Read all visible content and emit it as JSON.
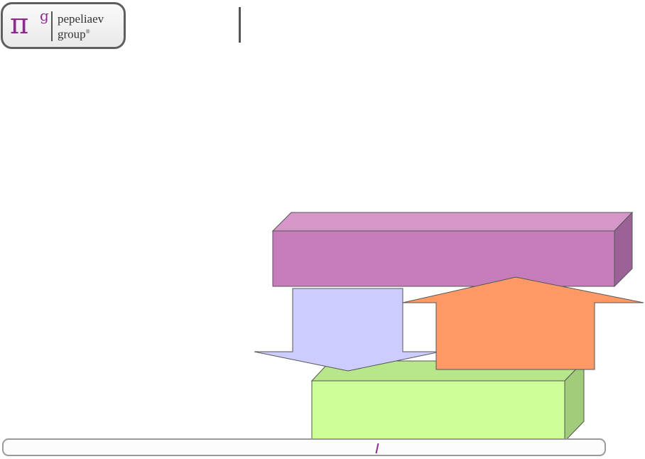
{
  "logo": {
    "symbol": "π",
    "superscript": "g",
    "line1": "pepeliaev",
    "line2": "group",
    "registered": "®"
  },
  "colors": {
    "brand_purple": "#8a2c8c",
    "top_box_front": "#c77dbb",
    "top_box_top": "#d596c8",
    "top_box_side": "#9c6298",
    "down_arrow": "#ccccff",
    "up_arrow": "#ff9966",
    "bottom_box_front": "#ccff99",
    "bottom_box_top": "#b8e68a",
    "bottom_box_side": "#a3cc7a"
  },
  "diagram": {
    "top_block": "",
    "down_arrow": "",
    "up_arrow": "",
    "bottom_block": ""
  }
}
